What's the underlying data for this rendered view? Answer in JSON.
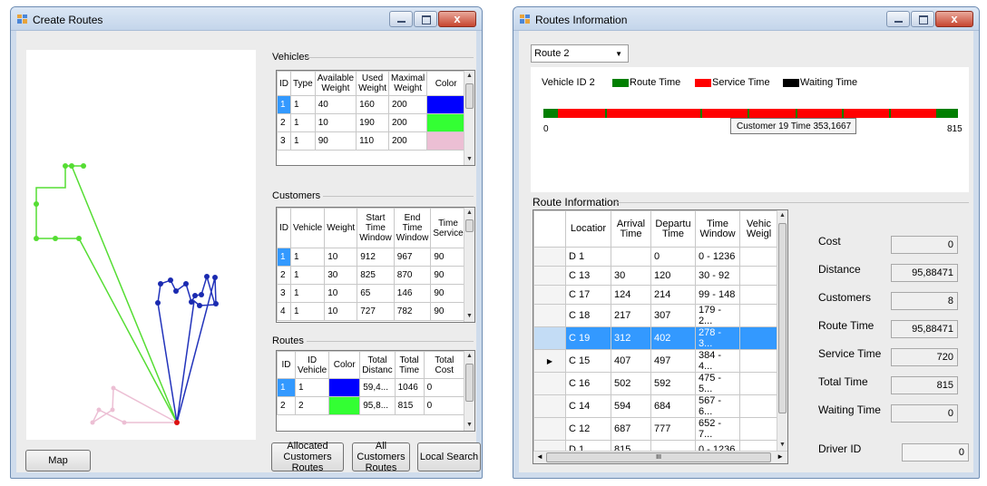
{
  "create_routes": {
    "title": "Create Routes",
    "vehicles": {
      "label": "Vehicles",
      "headers": [
        "ID",
        "Type",
        "Available Weight",
        "Used Weight",
        "Maximal Weight",
        "Color"
      ],
      "rows": [
        {
          "id": "1",
          "type": "1",
          "available": "40",
          "used": "160",
          "max": "200",
          "color": "#0000ff"
        },
        {
          "id": "2",
          "type": "1",
          "available": "10",
          "used": "190",
          "max": "200",
          "color": "#33ff33"
        },
        {
          "id": "3",
          "type": "1",
          "available": "90",
          "used": "110",
          "max": "200",
          "color": "#ecbfd4"
        }
      ]
    },
    "customers": {
      "label": "Customers",
      "headers": [
        "ID",
        "Vehicle",
        "Weight",
        "Start Time Window",
        "End Time Window",
        "Time Service"
      ],
      "rows": [
        [
          "1",
          "1",
          "10",
          "912",
          "967",
          "90"
        ],
        [
          "2",
          "1",
          "30",
          "825",
          "870",
          "90"
        ],
        [
          "3",
          "1",
          "10",
          "65",
          "146",
          "90"
        ],
        [
          "4",
          "1",
          "10",
          "727",
          "782",
          "90"
        ]
      ]
    },
    "routes": {
      "label": "Routes",
      "headers": [
        "ID",
        "ID Vehicle",
        "Color",
        "Total Distanc",
        "Total Time",
        "Total Cost"
      ],
      "rows": [
        {
          "id": "1",
          "vehicle": "1",
          "color": "#0000ff",
          "distance": "59,4...",
          "time": "1046",
          "cost": "0"
        },
        {
          "id": "2",
          "vehicle": "2",
          "color": "#33ff33",
          "distance": "95,8...",
          "time": "815",
          "cost": "0"
        }
      ]
    },
    "buttons": {
      "map": "Map",
      "allocated": "Allocated Customers Routes",
      "all_customers": "All Customers Routes",
      "local_search": "Local Search"
    }
  },
  "routes_info": {
    "title": "Routes Information",
    "route_select": "Route 2",
    "chart_legend": {
      "vehicle": "Vehicle ID 2",
      "route_time": "Route Time",
      "service_time": "Service Time",
      "waiting_time": "Waiting Time"
    },
    "colors": {
      "route": "#007f00",
      "service": "#ff0000",
      "waiting": "#000000"
    },
    "timeline_start": "0",
    "timeline_end": "815",
    "tooltip": "Customer 19 Time 353,1667",
    "route_info_label": "Route Information",
    "table_headers": [
      "Locatior",
      "Arrival Time",
      "Departu Time",
      "Time Window",
      "Vehic Weigl"
    ],
    "rows": [
      [
        "D 1",
        "",
        "0",
        "0 - 1236",
        ""
      ],
      [
        "C 13",
        "30",
        "120",
        "30 - 92",
        ""
      ],
      [
        "C 17",
        "124",
        "214",
        "99 - 148",
        ""
      ],
      [
        "C 18",
        "217",
        "307",
        "179 - 2...",
        ""
      ],
      [
        "C 19",
        "312",
        "402",
        "278 - 3...",
        ""
      ],
      [
        "C 15",
        "407",
        "497",
        "384 - 4...",
        ""
      ],
      [
        "C 16",
        "502",
        "592",
        "475 - 5...",
        ""
      ],
      [
        "C 14",
        "594",
        "684",
        "567 - 6...",
        ""
      ],
      [
        "C 12",
        "687",
        "777",
        "652 - 7...",
        ""
      ],
      [
        "D 1",
        "815",
        "",
        "0 - 1236",
        ""
      ]
    ],
    "selected_row": 4,
    "current_row": 5,
    "stats": [
      {
        "label": "Cost",
        "value": "0"
      },
      {
        "label": "Distance",
        "value": "95,88471"
      },
      {
        "label": "Customers",
        "value": "8"
      },
      {
        "label": "Route Time",
        "value": "95,88471"
      },
      {
        "label": "Service Time",
        "value": "720"
      },
      {
        "label": "Total Time",
        "value": "815"
      },
      {
        "label": "Waiting Time",
        "value": "0"
      }
    ],
    "driver": {
      "label": "Driver ID",
      "value": "0"
    }
  }
}
